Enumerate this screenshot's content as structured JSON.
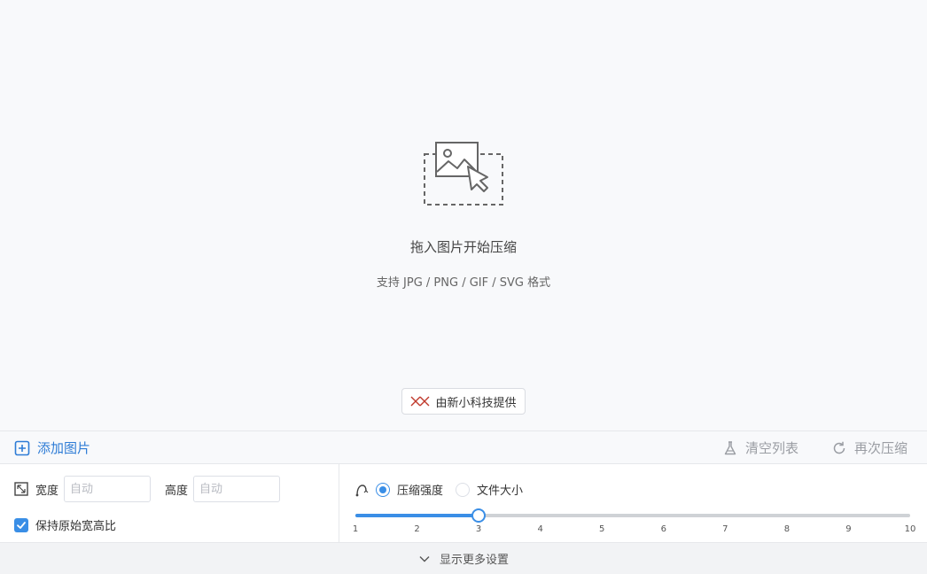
{
  "drop_zone": {
    "title": "拖入图片开始压缩",
    "subtitle": "支持 JPG / PNG / GIF / SVG 格式",
    "icon": "image-drop-icon",
    "provider_label": "由新小科技提供"
  },
  "toolbar": {
    "add_label": "添加图片",
    "clear_label": "清空列表",
    "recompress_label": "再次压缩"
  },
  "size": {
    "width_label": "宽度",
    "height_label": "高度",
    "width_placeholder": "自动",
    "height_placeholder": "自动",
    "keep_ratio_label": "保持原始宽高比",
    "keep_ratio_checked": true
  },
  "compression": {
    "mode_strength_label": "压缩强度",
    "mode_size_label": "文件大小",
    "selected_mode": "压缩强度",
    "slider_min": 1,
    "slider_max": 10,
    "slider_value": 3,
    "ticks": [
      "1",
      "2",
      "3",
      "4",
      "5",
      "6",
      "7",
      "8",
      "9",
      "10"
    ]
  },
  "footer": {
    "more_label": "显示更多设置"
  },
  "colors": {
    "accent": "#3a8ee6",
    "link": "#2e7cd6",
    "disabled": "#9a9da3"
  }
}
